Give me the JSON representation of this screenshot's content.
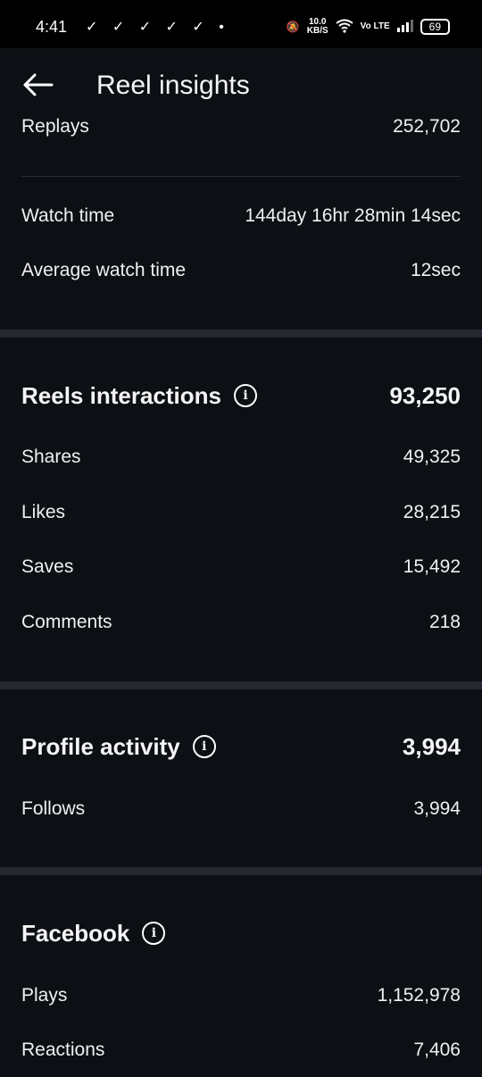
{
  "status_bar": {
    "time": "4:41",
    "notification_icons": "✓ ✓ ✓ ✓ ✓ •",
    "speed_value": "10.0",
    "speed_unit": "KB/S",
    "network_label": "Vo LTE",
    "battery": "69"
  },
  "header": {
    "title": "Reel insights"
  },
  "top_rows": {
    "replays_label": "Replays",
    "replays_value": "252,702",
    "watch_time_label": "Watch time",
    "watch_time_value": "144day 16hr 28min 14sec",
    "avg_watch_label": "Average watch time",
    "avg_watch_value": "12sec"
  },
  "reels_interactions": {
    "title": "Reels interactions",
    "total": "93,250",
    "rows": [
      {
        "label": "Shares",
        "value": "49,325"
      },
      {
        "label": "Likes",
        "value": "28,215"
      },
      {
        "label": "Saves",
        "value": "15,492"
      },
      {
        "label": "Comments",
        "value": "218"
      }
    ]
  },
  "profile_activity": {
    "title": "Profile activity",
    "total": "3,994",
    "rows": [
      {
        "label": "Follows",
        "value": "3,994"
      }
    ]
  },
  "facebook": {
    "title": "Facebook",
    "rows": [
      {
        "label": "Plays",
        "value": "1,152,978"
      },
      {
        "label": "Reactions",
        "value": "7,406"
      }
    ]
  }
}
